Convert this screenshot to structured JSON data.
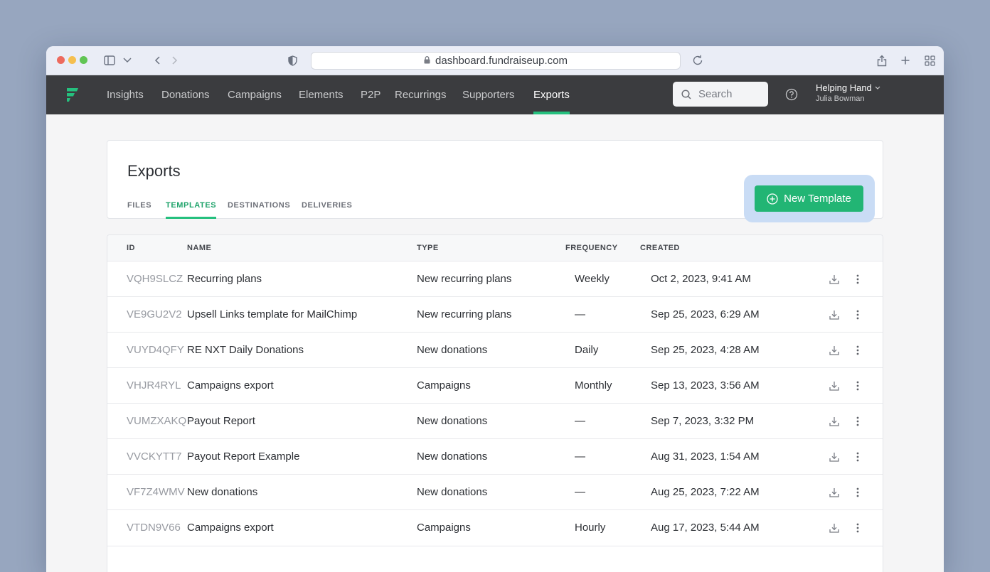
{
  "browser": {
    "url": "dashboard.fundraiseup.com",
    "traffic_colors": [
      "#ed6a5e",
      "#f5bf4f",
      "#61c554"
    ]
  },
  "nav": {
    "items": [
      "Insights",
      "Donations",
      "Campaigns",
      "Elements",
      "P2P",
      "Recurrings",
      "Supporters",
      "Exports"
    ],
    "active": "Exports",
    "search_placeholder": "Search",
    "org_name": "Helping Hand",
    "user_name": "Julia Bowman"
  },
  "page": {
    "title": "Exports",
    "tabs": [
      "FILES",
      "TEMPLATES",
      "DESTINATIONS",
      "DELIVERIES"
    ],
    "active_tab": "TEMPLATES",
    "new_button": "New Template"
  },
  "table": {
    "headers": [
      "ID",
      "NAME",
      "TYPE",
      "FREQUENCY",
      "CREATED"
    ],
    "rows": [
      {
        "id": "VQH9SLCZ",
        "name": "Recurring plans",
        "type": "New recurring plans",
        "frequency": "Weekly",
        "created": "Oct 2, 2023, 9:41 AM"
      },
      {
        "id": "VE9GU2V2",
        "name": "Upsell Links template for MailChimp",
        "type": "New recurring plans",
        "frequency": "—",
        "created": "Sep 25, 2023, 6:29 AM"
      },
      {
        "id": "VUYD4QFY",
        "name": "RE NXT Daily Donations",
        "type": "New donations",
        "frequency": "Daily",
        "created": "Sep 25, 2023, 4:28 AM"
      },
      {
        "id": "VHJR4RYL",
        "name": "Campaigns export",
        "type": "Campaigns",
        "frequency": "Monthly",
        "created": "Sep 13, 2023, 3:56 AM"
      },
      {
        "id": "VUMZXAKQ",
        "name": "Payout Report",
        "type": "New donations",
        "frequency": "—",
        "created": "Sep 7, 2023, 3:32 PM"
      },
      {
        "id": "VVCKYTT7",
        "name": "Payout Report Example",
        "type": "New donations",
        "frequency": "—",
        "created": "Aug 31, 2023, 1:54 AM"
      },
      {
        "id": "VF7Z4WMV",
        "name": "New donations",
        "type": "New donations",
        "frequency": "—",
        "created": "Aug 25, 2023, 7:22 AM"
      },
      {
        "id": "VTDN9V66",
        "name": "Campaigns export",
        "type": "Campaigns",
        "frequency": "Hourly",
        "created": "Aug 17, 2023, 5:44 AM"
      }
    ]
  },
  "colors": {
    "accent": "#22b574",
    "navbar": "#3b3c3f",
    "desktop": "#97a6bf"
  }
}
